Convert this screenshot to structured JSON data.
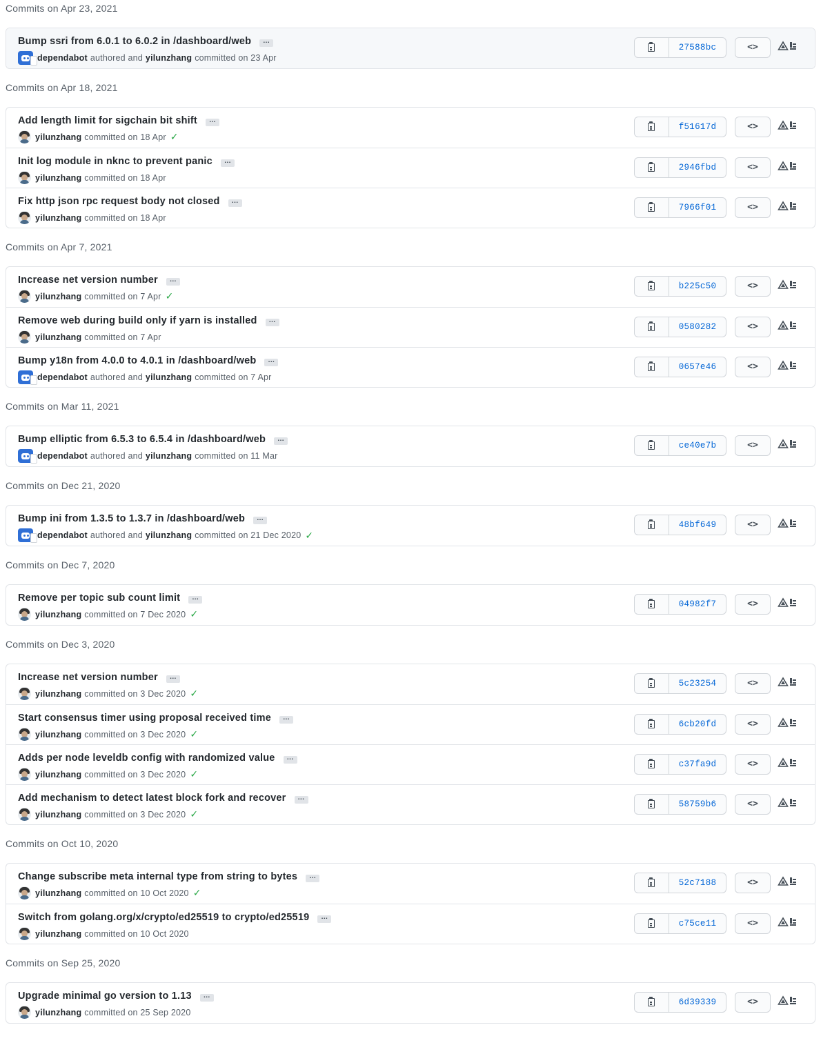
{
  "groups": [
    {
      "header": "Commits on Apr 23, 2021",
      "commits": [
        {
          "title": "Bump ssri from 6.0.1 to 6.0.2 in /dashboard/web",
          "author": "dependabot",
          "bot": true,
          "authored_text": "authored and",
          "committer": "yilunzhang",
          "committed_text": "committed on 23 Apr",
          "check": false,
          "sha": "27588bc",
          "highlighted": true
        }
      ]
    },
    {
      "header": "Commits on Apr 18, 2021",
      "commits": [
        {
          "title": "Add length limit for sigchain bit shift",
          "author": "yilunzhang",
          "bot": false,
          "committed_text": "committed on 18 Apr",
          "check": true,
          "sha": "f51617d"
        },
        {
          "title": "Init log module in nknc to prevent panic",
          "author": "yilunzhang",
          "bot": false,
          "committed_text": "committed on 18 Apr",
          "check": false,
          "sha": "2946fbd"
        },
        {
          "title": "Fix http json rpc request body not closed",
          "author": "yilunzhang",
          "bot": false,
          "committed_text": "committed on 18 Apr",
          "check": false,
          "sha": "7966f01"
        }
      ]
    },
    {
      "header": "Commits on Apr 7, 2021",
      "commits": [
        {
          "title": "Increase net version number",
          "author": "yilunzhang",
          "bot": false,
          "committed_text": "committed on 7 Apr",
          "check": true,
          "sha": "b225c50"
        },
        {
          "title": "Remove web during build only if yarn is installed",
          "author": "yilunzhang",
          "bot": false,
          "committed_text": "committed on 7 Apr",
          "check": false,
          "sha": "0580282"
        },
        {
          "title": "Bump y18n from 4.0.0 to 4.0.1 in /dashboard/web",
          "author": "dependabot",
          "bot": true,
          "authored_text": "authored and",
          "committer": "yilunzhang",
          "committed_text": "committed on 7 Apr",
          "check": false,
          "sha": "0657e46"
        }
      ]
    },
    {
      "header": "Commits on Mar 11, 2021",
      "commits": [
        {
          "title": "Bump elliptic from 6.5.3 to 6.5.4 in /dashboard/web",
          "author": "dependabot",
          "bot": true,
          "authored_text": "authored and",
          "committer": "yilunzhang",
          "committed_text": "committed on 11 Mar",
          "check": false,
          "sha": "ce40e7b"
        }
      ]
    },
    {
      "header": "Commits on Dec 21, 2020",
      "commits": [
        {
          "title": "Bump ini from 1.3.5 to 1.3.7 in /dashboard/web",
          "author": "dependabot",
          "bot": true,
          "authored_text": "authored and",
          "committer": "yilunzhang",
          "committed_text": "committed on 21 Dec 2020",
          "check": true,
          "sha": "48bf649"
        }
      ]
    },
    {
      "header": "Commits on Dec 7, 2020",
      "commits": [
        {
          "title": "Remove per topic sub count limit",
          "author": "yilunzhang",
          "bot": false,
          "committed_text": "committed on 7 Dec 2020",
          "check": true,
          "sha": "04982f7"
        }
      ]
    },
    {
      "header": "Commits on Dec 3, 2020",
      "commits": [
        {
          "title": "Increase net version number",
          "author": "yilunzhang",
          "bot": false,
          "committed_text": "committed on 3 Dec 2020",
          "check": true,
          "sha": "5c23254"
        },
        {
          "title": "Start consensus timer using proposal received time",
          "author": "yilunzhang",
          "bot": false,
          "committed_text": "committed on 3 Dec 2020",
          "check": true,
          "sha": "6cb20fd"
        },
        {
          "title": "Adds per node leveldb config with randomized value",
          "author": "yilunzhang",
          "bot": false,
          "committed_text": "committed on 3 Dec 2020",
          "check": true,
          "sha": "c37fa9d"
        },
        {
          "title": "Add mechanism to detect latest block fork and recover",
          "author": "yilunzhang",
          "bot": false,
          "committed_text": "committed on 3 Dec 2020",
          "check": true,
          "sha": "58759b6"
        }
      ]
    },
    {
      "header": "Commits on Oct 10, 2020",
      "commits": [
        {
          "title": "Change subscribe meta internal type from string to bytes",
          "author": "yilunzhang",
          "bot": false,
          "committed_text": "committed on 10 Oct 2020",
          "check": true,
          "sha": "52c7188"
        },
        {
          "title": "Switch from golang.org/x/crypto/ed25519 to crypto/ed25519",
          "author": "yilunzhang",
          "bot": false,
          "committed_text": "committed on 10 Oct 2020",
          "check": false,
          "sha": "c75ce11"
        }
      ]
    },
    {
      "header": "Commits on Sep 25, 2020",
      "commits": [
        {
          "title": "Upgrade minimal go version to 1.13",
          "author": "yilunzhang",
          "bot": false,
          "committed_text": "committed on 25 Sep 2020",
          "check": false,
          "sha": "6d39339"
        }
      ]
    }
  ],
  "labels": {
    "ellipsis": "…",
    "browse": "<>",
    "check": "✓"
  },
  "icons": {
    "copy": "clippy-icon",
    "browse": "code-icon",
    "bot_avatar": "dependabot-avatar-icon",
    "user_avatar": "user-avatar-icon",
    "status": "check-icon",
    "extra": "triangle-icon"
  },
  "colors": {
    "sha_link": "#0366d6",
    "success": "#28a745",
    "bot_avatar": "#2f6fd6"
  }
}
